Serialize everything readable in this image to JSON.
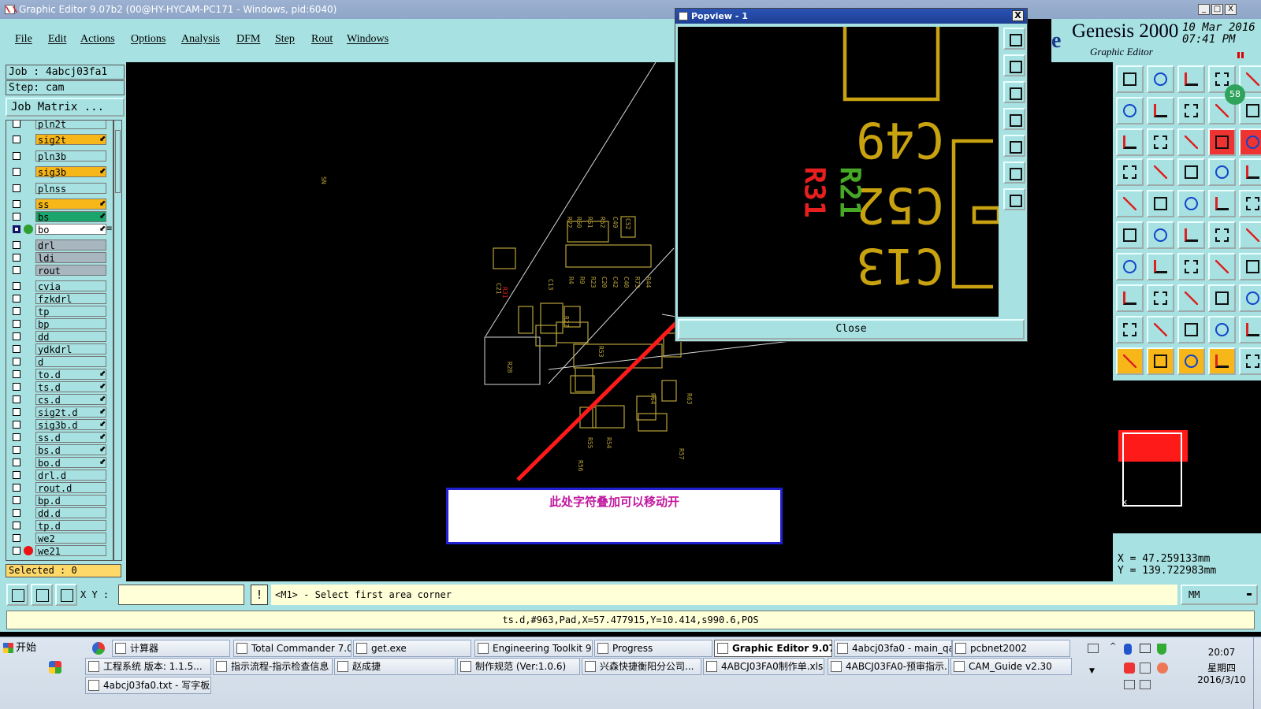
{
  "window": {
    "title": "Graphic Editor 9.07b2 (00@HY-HYCAM-PC171 - Windows, pid:6040)",
    "btn_min": "_",
    "btn_max": "□",
    "btn_close": "X"
  },
  "menu": [
    "File",
    "Edit",
    "Actions",
    "Options",
    "Analysis",
    "DFM",
    "Step",
    "Rout",
    "Windows"
  ],
  "logo": {
    "title": "Genesis 2000",
    "sub": "Graphic Editor",
    "date": "10 Mar 2016",
    "time": "07:41 PM",
    "e": "e"
  },
  "job": {
    "job_line": "Job : 4abcj03fa1",
    "step_line": "Step: cam",
    "matrix_btn": "Job Matrix ..."
  },
  "layers": [
    {
      "name": "pln2t",
      "color": "#a7e1e1",
      "flag": ""
    },
    {
      "name": "sig2t",
      "color": "#f7b719",
      "flag": "⬋"
    },
    {
      "name": "pln3b",
      "color": "#a7e1e1",
      "flag": ""
    },
    {
      "name": "sig3b",
      "color": "#f7b719",
      "flag": "⬋"
    },
    {
      "name": "plnss",
      "color": "#a7e1e1",
      "flag": ""
    },
    {
      "name": "ss",
      "color": "#f7b719",
      "flag": "⬋"
    },
    {
      "name": "bs",
      "color": "#1ba46c",
      "flag": "⬋"
    },
    {
      "name": "bo",
      "color": "#ffffff",
      "flag": "⬋≡"
    },
    {
      "name": "drl",
      "color": "#a7b6bf",
      "flag": ""
    },
    {
      "name": "ldi",
      "color": "#a7b6bf",
      "flag": ""
    },
    {
      "name": "rout",
      "color": "#a7b6bf",
      "flag": ""
    },
    {
      "name": "cvia",
      "color": "#a7e1e1",
      "flag": ""
    },
    {
      "name": "fzkdrl",
      "color": "#a7e1e1",
      "flag": ""
    },
    {
      "name": "tp",
      "color": "#a7e1e1",
      "flag": ""
    },
    {
      "name": "bp",
      "color": "#a7e1e1",
      "flag": ""
    },
    {
      "name": "dd",
      "color": "#a7e1e1",
      "flag": ""
    },
    {
      "name": "ydkdrl",
      "color": "#a7e1e1",
      "flag": ""
    },
    {
      "name": "d",
      "color": "#a7e1e1",
      "flag": ""
    },
    {
      "name": "to.d",
      "color": "#a7e1e1",
      "flag": "⬋"
    },
    {
      "name": "ts.d",
      "color": "#a7e1e1",
      "flag": "⬋"
    },
    {
      "name": "cs.d",
      "color": "#a7e1e1",
      "flag": "⬋"
    },
    {
      "name": "sig2t.d",
      "color": "#a7e1e1",
      "flag": "⬋"
    },
    {
      "name": "sig3b.d",
      "color": "#a7e1e1",
      "flag": "⬋"
    },
    {
      "name": "ss.d",
      "color": "#a7e1e1",
      "flag": "⬋"
    },
    {
      "name": "bs.d",
      "color": "#a7e1e1",
      "flag": "⬋"
    },
    {
      "name": "bo.d",
      "color": "#a7e1e1",
      "flag": "⬋"
    },
    {
      "name": "drl.d",
      "color": "#a7e1e1",
      "flag": ""
    },
    {
      "name": "rout.d",
      "color": "#a7e1e1",
      "flag": ""
    },
    {
      "name": "bp.d",
      "color": "#a7e1e1",
      "flag": ""
    },
    {
      "name": "dd.d",
      "color": "#a7e1e1",
      "flag": ""
    },
    {
      "name": "tp.d",
      "color": "#a7e1e1",
      "flag": ""
    },
    {
      "name": "we2",
      "color": "#a7e1e1",
      "flag": ""
    },
    {
      "name": "we21",
      "color": "#a7e1e1",
      "flag": ""
    }
  ],
  "selected": "Selected : 0",
  "popview": {
    "title": "Popview - 1",
    "close_x": "X",
    "close_btn": "Close"
  },
  "board_labels": [
    "SN",
    "R31",
    "R22",
    "R50",
    "R51",
    "R52",
    "C49",
    "C52",
    "C13",
    "C21",
    "R4",
    "R9",
    "R23",
    "C20",
    "C42",
    "C40",
    "R73",
    "R44",
    "R53",
    "R54",
    "R55",
    "R56",
    "R57",
    "R63",
    "R64",
    "R27",
    "R28"
  ],
  "annotation": {
    "text": "此处字符叠加可以移动开"
  },
  "popview_labels": [
    "C49",
    "C52",
    "C13",
    "R31",
    "R21"
  ],
  "coords": {
    "x_line": "X  =  47.259133mm",
    "y_line": "Y  =  139.722983mm"
  },
  "minimap": {
    "marker": "×"
  },
  "tool_badge": "58",
  "cmdbar": {
    "xy_label": "X Y :",
    "input_value": "",
    "prompt": "<M1> - Select first area corner",
    "unit": "MM",
    "unit_arrow": "▬",
    "warn": "!"
  },
  "status": {
    "text": "ts.d,#963,Pad,X=57.477915,Y=10.414,s990.6,POS"
  },
  "taskbar": {
    "start": "开始",
    "row1": [
      "计算器",
      "Total Commander 7.0 p...",
      "get.exe",
      "Engineering Toolkit 9.0...",
      "Progress",
      "Graphic Editor 9.07b...",
      "4abcj03fa0 - main_qa",
      "pcbnet2002"
    ],
    "row2": [
      "工程系统  版本: 1.1.5...",
      "指示流程-指示检查信息",
      "赵成捷",
      "制作规范 (Ver:1.0.6)",
      "兴森快捷衡阳分公司...",
      "4ABCJ03FA0制作单.xls ...",
      "4ABCJ03FA0-预审指示...",
      "CAM_Guide v2.30"
    ],
    "row3": [
      "4abcj03fa0.txt - 写字板"
    ],
    "clock_time": "20:07",
    "clock_day": "星期四",
    "clock_date": "2016/3/10"
  }
}
